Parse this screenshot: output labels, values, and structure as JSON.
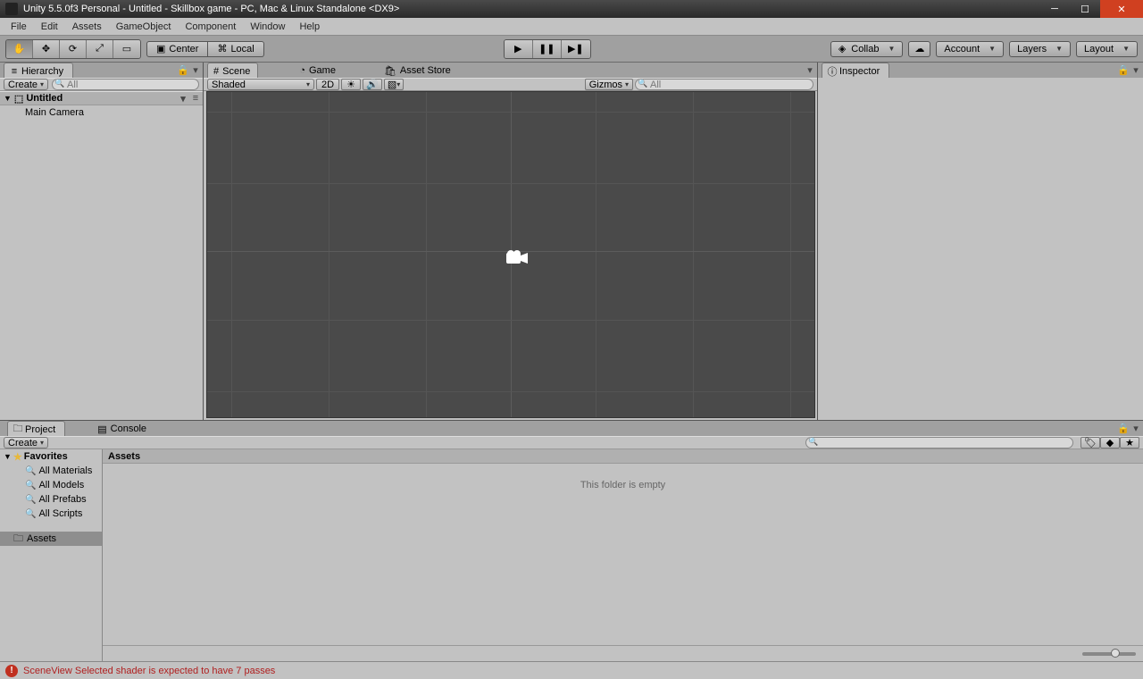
{
  "titlebar": {
    "text": "Unity 5.5.0f3 Personal - Untitled - Skillbox game - PC, Mac & Linux Standalone <DX9>"
  },
  "menubar": [
    "File",
    "Edit",
    "Assets",
    "GameObject",
    "Component",
    "Window",
    "Help"
  ],
  "toolbar": {
    "center": "Center",
    "local": "Local",
    "collab": "Collab",
    "account": "Account",
    "layers": "Layers",
    "layout": "Layout"
  },
  "hierarchy": {
    "tab": "Hierarchy",
    "create": "Create",
    "search_placeholder": "All",
    "scene": "Untitled",
    "objects": [
      "Main Camera"
    ]
  },
  "scene_view": {
    "tabs": {
      "scene": "Scene",
      "game": "Game",
      "asset_store": "Asset Store"
    },
    "shading": "Shaded",
    "toggle_2d": "2D",
    "gizmos": "Gizmos",
    "search_placeholder": "All"
  },
  "inspector": {
    "tab": "Inspector"
  },
  "project": {
    "tabs": {
      "project": "Project",
      "console": "Console"
    },
    "create": "Create",
    "favorites_label": "Favorites",
    "favorites": [
      "All Materials",
      "All Models",
      "All Prefabs",
      "All Scripts"
    ],
    "assets_root": "Assets",
    "breadcrumb": "Assets",
    "empty_text": "This folder is empty"
  },
  "statusbar": {
    "message": "SceneView Selected shader is expected to have 7 passes"
  }
}
